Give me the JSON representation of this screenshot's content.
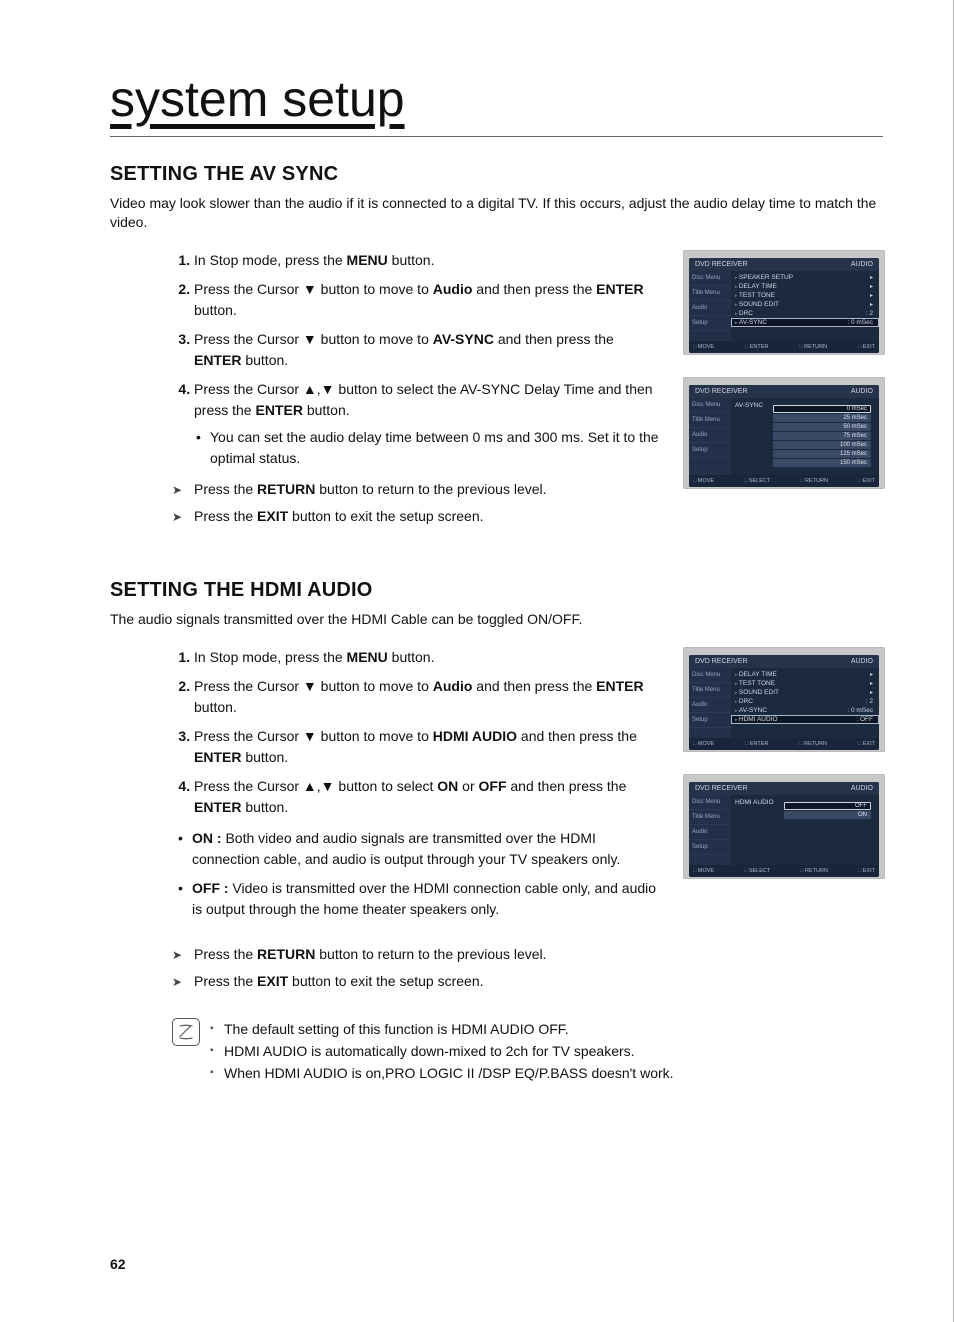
{
  "page": {
    "title": "system setup",
    "number": "62"
  },
  "avsync": {
    "heading": "SETTING THE AV SYNC",
    "lead": "Video may look slower than the audio if it is connected to a digital TV. If this occurs, adjust the audio delay time to match the video.",
    "step1_a": "In Stop mode, press the ",
    "step1_b": "MENU",
    "step1_c": " button.",
    "step2_a": "Press the Cursor ▼ button to move to ",
    "step2_b": "Audio",
    "step2_c": " and then press the ",
    "step2_d": "ENTER",
    "step2_e": " button.",
    "step3_a": "Press the Cursor ▼ button to move to ",
    "step3_b": "AV-SYNC",
    "step3_c": " and then press the ",
    "step3_d": "ENTER",
    "step3_e": " button.",
    "step4_a": "Press the Cursor ▲,▼ button to select the AV-SYNC Delay Time and then press the ",
    "step4_b": "ENTER",
    "step4_c": " button.",
    "step4_sub": "You can set the audio delay time between 0 ms and 300 ms. Set it to the optimal status.",
    "return_a": "Press the ",
    "return_b": "RETURN",
    "return_c": " button to return to the previous level.",
    "exit_a": "Press the ",
    "exit_b": "EXIT",
    "exit_c": " button to exit the setup screen."
  },
  "hdmi": {
    "heading": "SETTING THE HDMI AUDIO",
    "lead": "The audio signals transmitted over the HDMI Cable can be toggled ON/OFF.",
    "step1_a": "In Stop mode, press the ",
    "step1_b": "MENU",
    "step1_c": " button.",
    "step2_a": "Press the Cursor  ▼ button to move to ",
    "step2_b": "Audio",
    "step2_c": " and then press the ",
    "step2_d": "ENTER",
    "step2_e": " button.",
    "step3_a": "Press the Cursor ▼ button to move to ",
    "step3_b": "HDMI AUDIO",
    "step3_c": " and then press the ",
    "step3_d": "ENTER",
    "step3_e": " button.",
    "step4_a": "Press the Cursor ▲,▼ button to select ",
    "step4_b": "ON",
    "step4_c": " or ",
    "step4_d": "OFF",
    "step4_e": " and then press the ",
    "step4_f": "ENTER",
    "step4_g": " button.",
    "on_label": "ON :",
    "on_text": " Both video and audio signals are transmitted over the HDMI connection cable, and audio is output through your TV speakers only.",
    "off_label": "OFF :",
    "off_text": " Video is transmitted over the HDMI connection cable only, and audio is output through the home theater speakers only.",
    "note1": "The default setting of this function is HDMI AUDIO OFF.",
    "note2": "HDMI AUDIO is automatically down-mixed to 2ch for TV speakers.",
    "note3": "When HDMI AUDIO is on,PRO LOGIC II /DSP EQ/P.BASS doesn't work."
  },
  "osd": {
    "brand": "DVD RECEIVER",
    "cat": "AUDIO",
    "side": {
      "disc": "Disc Menu",
      "title": "Title Menu",
      "audio": "Audio",
      "setup": "Setup"
    },
    "menu1": {
      "r1": "SPEAKER SETUP",
      "r2": "DELAY TIME",
      "r3": "TEST TONE",
      "r4": "SOUND EDIT",
      "r5": "DRC",
      "r5v": ": 2",
      "r6": "AV-SYNC",
      "r6v": ": 0 mSec"
    },
    "menu2": {
      "key": "AV-SYNC",
      "o1": "0 mSec",
      "o2": "25 mSec",
      "o3": "50 mSec",
      "o4": "75 mSec",
      "o5": "100 mSec",
      "o6": "125 mSec",
      "o7": "150 mSec"
    },
    "menu3": {
      "r1": "DELAY TIME",
      "r2": "TEST TONE",
      "r3": "SOUND EDIT",
      "r4": "DRC",
      "r4v": ": 2",
      "r5": "AV-SYNC",
      "r5v": ": 0 mSec",
      "r6": "HDMI AUDIO",
      "r6v": ": OFF"
    },
    "menu4": {
      "key": "HDMI AUDIO",
      "o1": "OFF",
      "o2": "ON"
    },
    "foot": {
      "move": "MOVE",
      "enter": "ENTER",
      "select": "SELECT",
      "ret": "RETURN",
      "exit": "EXIT"
    }
  }
}
